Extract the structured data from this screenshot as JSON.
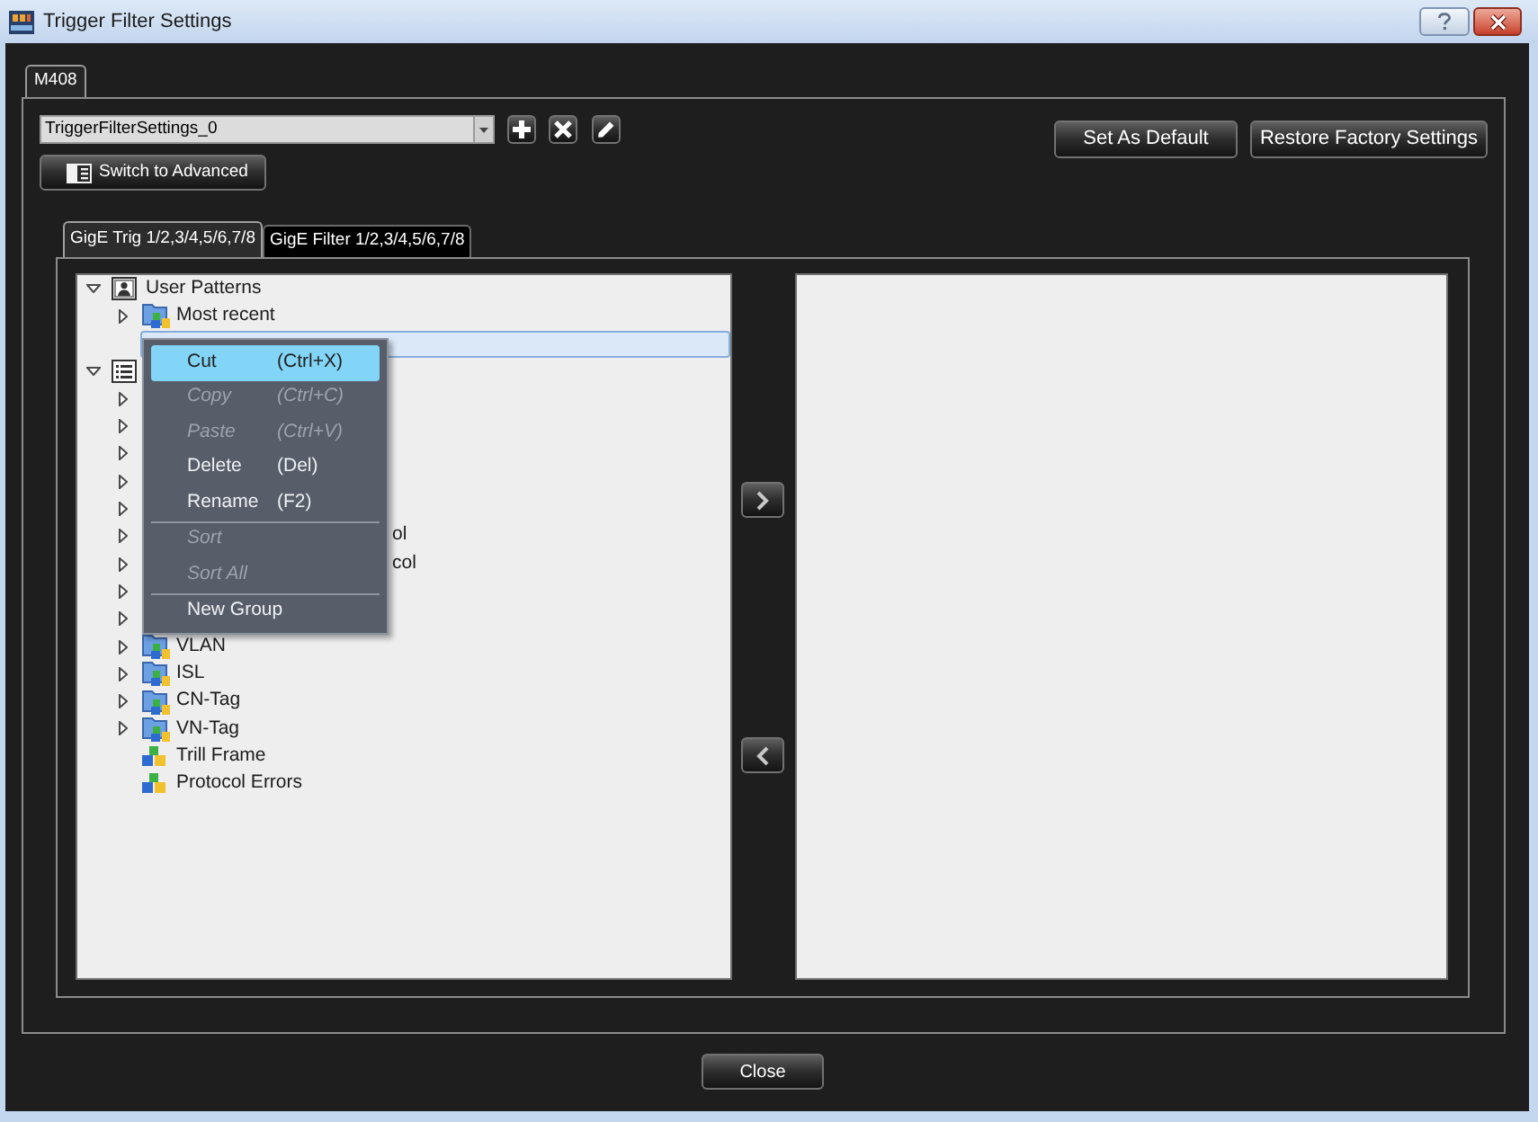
{
  "window": {
    "title": "Trigger Filter Settings"
  },
  "device_tabs": [
    {
      "label": "M408",
      "selected": true
    }
  ],
  "toolbar": {
    "preset": "TriggerFilterSettings_0",
    "switch_button": "Switch to Advanced",
    "default_button": "Set As Default",
    "restore_button": "Restore Factory Settings"
  },
  "port_tabs": [
    {
      "label": "GigE Trig 1/2,3/4,5/6,7/8",
      "selected": true
    },
    {
      "label": "GigE Filter 1/2,3/4,5/6,7/8",
      "selected": false
    }
  ],
  "tree": [
    {
      "kind": "user",
      "label": "User Patterns",
      "expanded": true,
      "selected": false,
      "children": [
        {
          "kind": "folder",
          "label": "Most recent",
          "expanded": false,
          "selected": false
        },
        {
          "kind": "covered",
          "selected": true
        }
      ]
    },
    {
      "kind": "list",
      "expanded": true,
      "selected": false,
      "children": [
        {
          "kind": "covered",
          "expanded": false,
          "selected": false
        },
        {
          "kind": "covered",
          "expanded": false,
          "selected": false
        },
        {
          "kind": "covered",
          "expanded": false,
          "selected": false
        },
        {
          "kind": "covered",
          "expanded": false,
          "selected": false
        },
        {
          "kind": "covered",
          "expanded": false,
          "selected": false
        },
        {
          "kind": "covered",
          "label": "ol",
          "expanded": false,
          "selected": false
        },
        {
          "kind": "covered",
          "label": "col",
          "expanded": false,
          "selected": false
        },
        {
          "kind": "covered",
          "expanded": false,
          "selected": false
        },
        {
          "kind": "covered",
          "expanded": false,
          "selected": false
        },
        {
          "kind": "folder",
          "label": "VLAN",
          "expanded": false,
          "selected": false
        },
        {
          "kind": "folder",
          "label": "ISL",
          "expanded": false,
          "selected": false
        },
        {
          "kind": "folder",
          "label": "CN-Tag",
          "expanded": false,
          "selected": false
        },
        {
          "kind": "folder",
          "label": "VN-Tag",
          "expanded": false,
          "selected": false
        },
        {
          "kind": "leaf",
          "label": "Trill Frame",
          "selected": false
        },
        {
          "kind": "leaf",
          "label": "Protocol Errors",
          "selected": false
        }
      ]
    }
  ],
  "context_menu": {
    "items": [
      {
        "kind": "item",
        "label": "Cut",
        "shortcut": "(Ctrl+X)",
        "disabled": false,
        "selected": true
      },
      {
        "kind": "item",
        "label": "Copy",
        "shortcut": "(Ctrl+C)",
        "disabled": true,
        "selected": false
      },
      {
        "kind": "item",
        "label": "Paste",
        "shortcut": "(Ctrl+V)",
        "disabled": true,
        "selected": false
      },
      {
        "kind": "item",
        "label": "Delete",
        "shortcut": "(Del)",
        "disabled": false,
        "selected": false
      },
      {
        "kind": "item",
        "label": "Rename",
        "shortcut": "(F2)",
        "disabled": false,
        "selected": false
      },
      {
        "kind": "separator"
      },
      {
        "kind": "item",
        "label": "Sort",
        "disabled": true,
        "selected": false
      },
      {
        "kind": "item",
        "label": "Sort All",
        "disabled": true,
        "selected": false
      },
      {
        "kind": "separator"
      },
      {
        "kind": "item",
        "label": "New Group",
        "disabled": false,
        "selected": false
      }
    ]
  },
  "footer": {
    "close_button": "Close"
  }
}
